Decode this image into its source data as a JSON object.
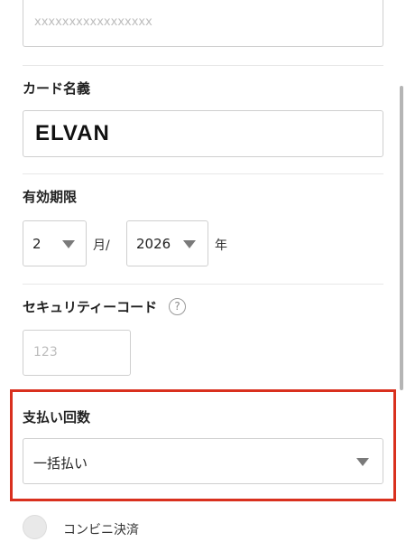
{
  "card_number": {
    "placeholder": "xxxxxxxxxxxxxxxxx"
  },
  "card_name": {
    "label": "カード名義",
    "value": "ELVAN"
  },
  "expiry": {
    "label": "有効期限",
    "month": "2",
    "month_unit": "月/",
    "year": "2026",
    "year_unit": "年"
  },
  "security_code": {
    "label": "セキュリティーコード",
    "help_glyph": "?",
    "placeholder": "123"
  },
  "installments": {
    "label": "支払い回数",
    "value": "一括払い"
  },
  "payment_option": {
    "label": "コンビニ決済"
  },
  "colors": {
    "highlight": "#d9301e",
    "border": "#cfcfcf",
    "scrollbar": "#b5b5b5"
  }
}
